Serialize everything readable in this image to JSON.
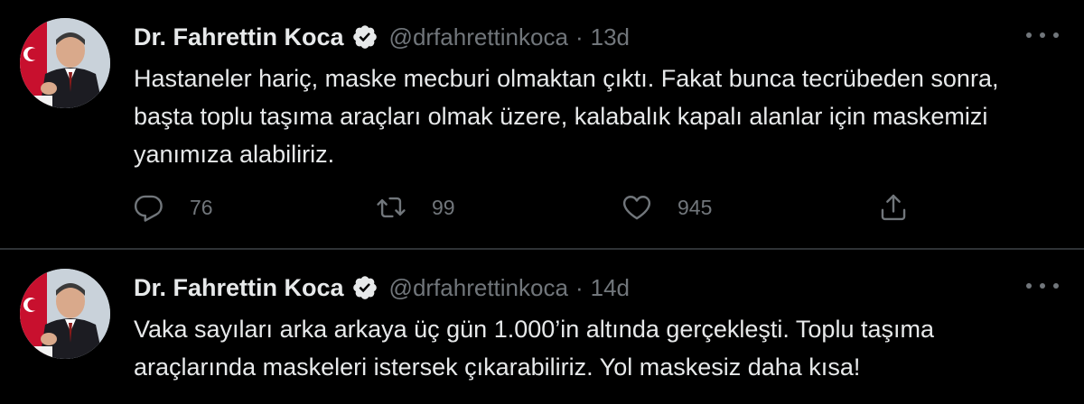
{
  "tweets": [
    {
      "display_name": "Dr. Fahrettin Koca",
      "handle": "@drfahrettinkoca",
      "separator": "·",
      "time": "13d",
      "text": "Hastaneler hariç, maske mecburi olmaktan çıktı. Fakat bunca tecrübeden sonra, başta toplu taşıma araçları olmak üzere, kalabalık kapalı alanlar için maskemizi yanımıza alabiliriz.",
      "replies": "76",
      "retweets": "99",
      "likes": "945"
    },
    {
      "display_name": "Dr. Fahrettin Koca",
      "handle": "@drfahrettinkoca",
      "separator": "·",
      "time": "14d",
      "text": "Vaka sayıları arka arkaya üç gün 1.000’in altında gerçekleşti. Toplu taşıma araçlarında maskeleri istersek çıkarabiliriz. Yol maskesiz daha kısa!"
    }
  ],
  "icons": {
    "verified": "verified-badge-icon",
    "more": "more-options-icon",
    "reply": "reply-icon",
    "retweet": "retweet-icon",
    "like": "like-icon",
    "share": "share-icon"
  },
  "colors": {
    "background": "#000000",
    "text": "#e7e9ea",
    "secondary": "#71767b",
    "divider": "#2f3336",
    "verified": "#e7e9ea"
  }
}
